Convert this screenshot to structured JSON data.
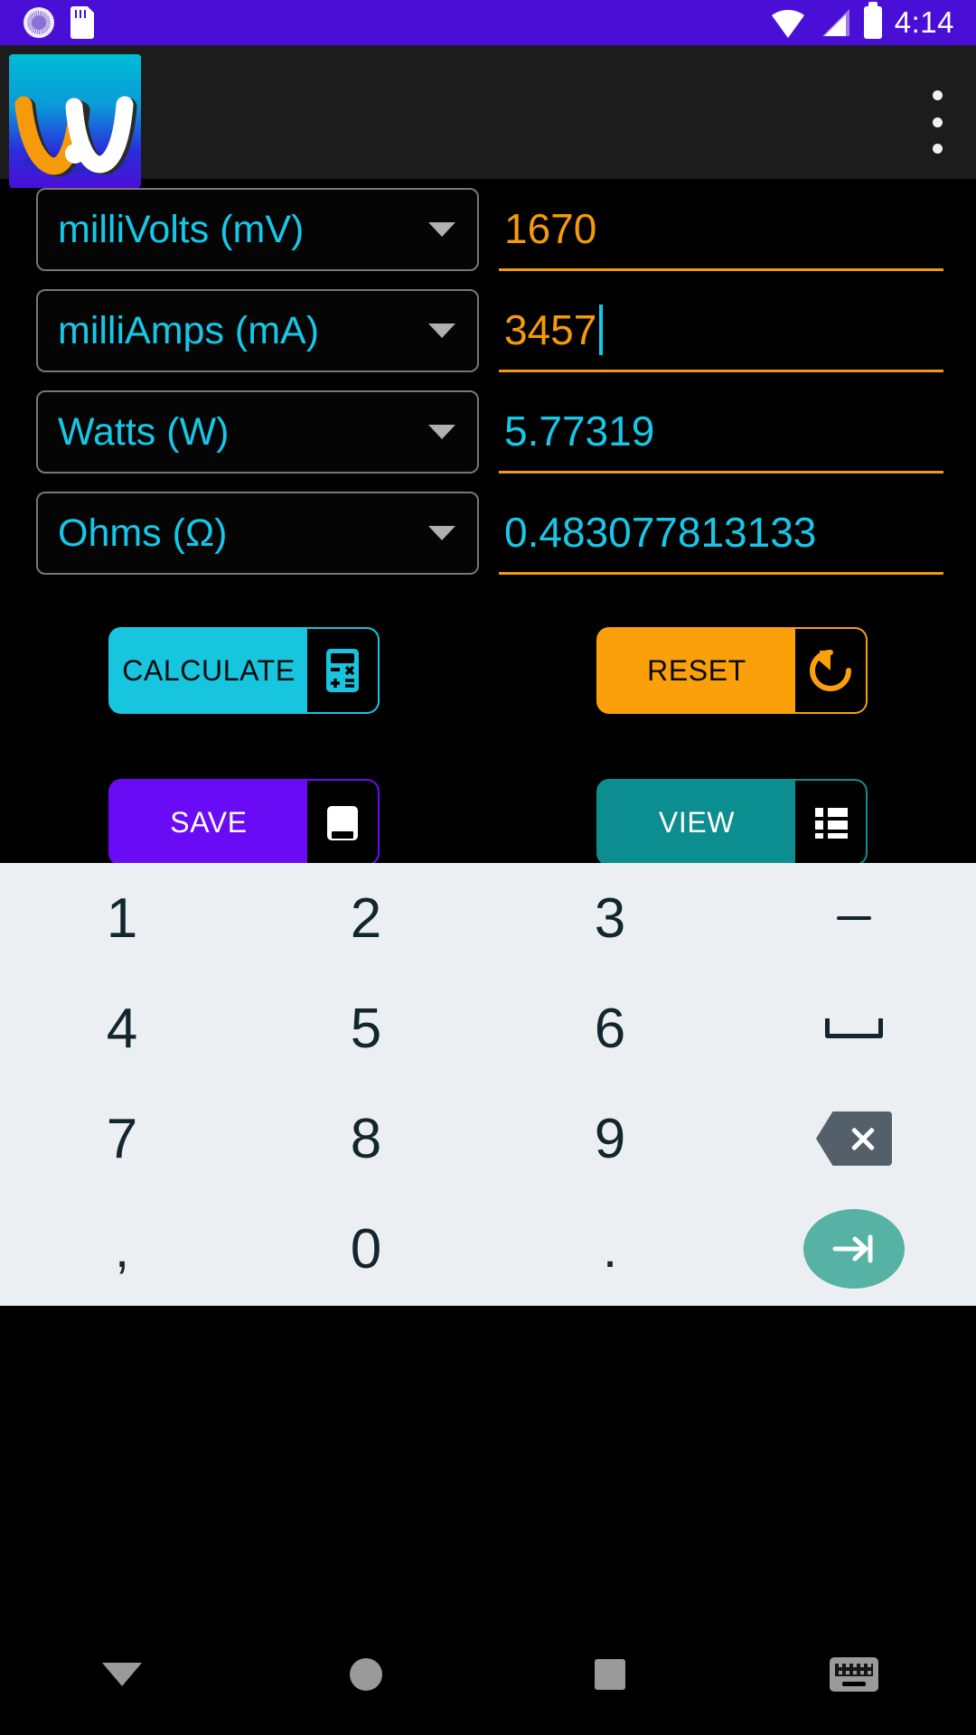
{
  "status_bar": {
    "time": "4:14",
    "icons": [
      "alarm-clock-icon",
      "sd-card-icon",
      "wifi-icon",
      "cell-signal-icon",
      "battery-icon"
    ]
  },
  "app_bar": {
    "logo_name": "app-logo-waveform",
    "overflow_label": "more-options"
  },
  "form": {
    "rows": [
      {
        "unit": "milliVolts (mV)",
        "value": "1670",
        "value_color": "#F59B0B",
        "focused": false
      },
      {
        "unit": "milliAmps (mA)",
        "value": "3457",
        "value_color": "#F59B0B",
        "focused": true
      },
      {
        "unit": "Watts (W)",
        "value": "5.77319",
        "value_color": "#16C8E8",
        "focused": false
      },
      {
        "unit": "Ohms (Ω)",
        "value": "0.483077813133",
        "value_color": "#16C8E8",
        "focused": false
      }
    ]
  },
  "buttons": {
    "calculate": {
      "label": "CALCULATE",
      "color": "#17C5DE",
      "icon": "calculator-icon"
    },
    "reset": {
      "label": "RESET",
      "color": "#FBA00B",
      "icon": "restore-icon"
    },
    "save": {
      "label": "SAVE",
      "color": "#6A0BF5",
      "icon": "save-icon"
    },
    "view": {
      "label": "VIEW",
      "color": "#0C8E90",
      "icon": "list-icon"
    }
  },
  "keyboard": {
    "rows": [
      [
        "1",
        "2",
        "3",
        "dash"
      ],
      [
        "4",
        "5",
        "6",
        "space"
      ],
      [
        "7",
        "8",
        "9",
        "backspace"
      ],
      [
        ",",
        "0",
        ".",
        "enter"
      ]
    ],
    "keys": {
      "r0": [
        "1",
        "2",
        "3"
      ],
      "r1": [
        "4",
        "5",
        "6"
      ],
      "r2": [
        "7",
        "8",
        "9"
      ],
      "r3": [
        ",",
        "0",
        "."
      ]
    }
  },
  "nav_bar": {
    "items": [
      "back-button",
      "home-button",
      "recents-button",
      "keyboard-toggle-button"
    ]
  }
}
